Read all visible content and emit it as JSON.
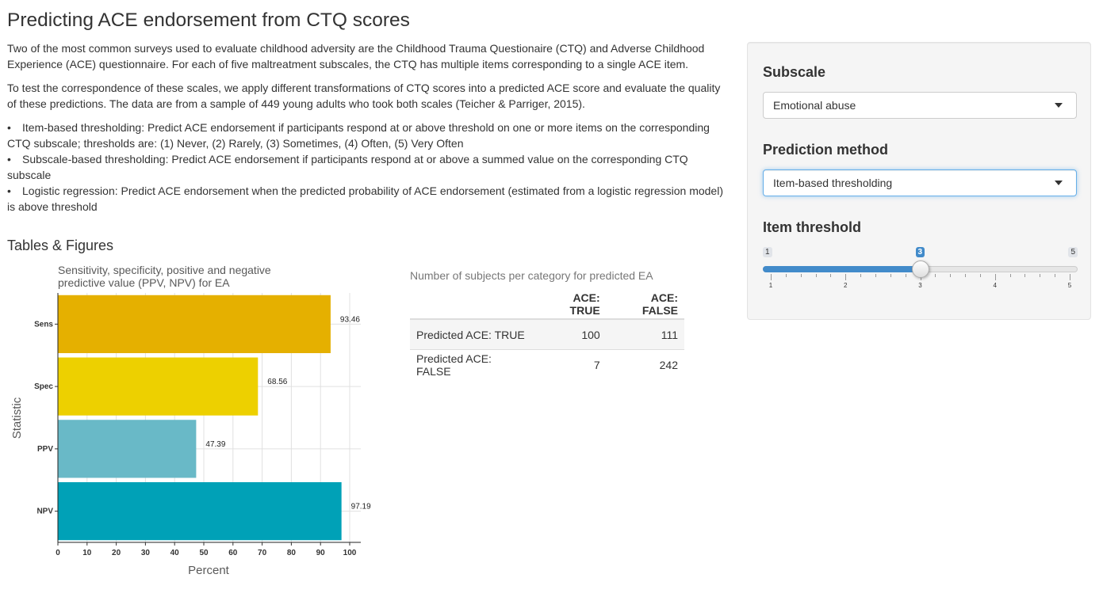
{
  "title": "Predicting ACE endorsement from CTQ scores",
  "intro": [
    "Two of the most common surveys used to evaluate childhood adversity are the Childhood Trauma Questionaire (CTQ) and Adverse Childhood Experience (ACE) questionnaire. For each of five maltreatment subscales, the CTQ has multiple items corresponding to a single ACE item.",
    "To test the correspondence of these scales, we apply different transformations of CTQ scores into a predicted ACE score and evaluate the quality of these predictions. The data are from a sample of 449 young adults who took both scales (Teicher & Parriger, 2015)."
  ],
  "methods": [
    "Item-based thresholding: Predict ACE endorsement if participants respond at or above threshold on one or more items on the corresponding CTQ subscale; thresholds are: (1) Never, (2) Rarely, (3) Sometimes, (4) Often, (5) Very Often",
    "Subscale-based thresholding: Predict ACE endorsement if participants respond at or above a summed value on the corresponding CTQ subscale",
    "Logistic regression: Predict ACE endorsement when the predicted probability of ACE endorsement (estimated from a logistic regression model) is above threshold"
  ],
  "section_heading": "Tables & Figures",
  "chart_data": {
    "type": "bar",
    "orientation": "horizontal",
    "title": "Sensitivity, specificity, positive and negative predictive value (PPV, NPV) for EA",
    "title_lines": [
      "Sensitivity, specificity, positive and negative",
      "predictive value (PPV, NPV) for EA"
    ],
    "xlabel": "Percent",
    "ylabel": "Statistic",
    "categories": [
      "Sens",
      "Spec",
      "PPV",
      "NPV"
    ],
    "values": [
      93.46,
      68.56,
      47.39,
      97.19
    ],
    "value_labels": [
      "93.46",
      "68.56",
      "47.39",
      "97.19"
    ],
    "colors": [
      "#e5b000",
      "#edd000",
      "#69b9c7",
      "#00a1b7"
    ],
    "xlim": [
      0,
      100
    ],
    "xticks": [
      0,
      10,
      20,
      30,
      40,
      50,
      60,
      70,
      80,
      90,
      100
    ],
    "grid": true
  },
  "table": {
    "caption": "Number of subjects per category for predicted EA",
    "headers": [
      "",
      "ACE: TRUE",
      "ACE: FALSE"
    ],
    "rows": [
      [
        "Predicted ACE: TRUE",
        "100",
        "111"
      ],
      [
        "Predicted ACE: FALSE",
        "7",
        "242"
      ]
    ]
  },
  "sidebar": {
    "subscale_label": "Subscale",
    "subscale_value": "Emotional abuse",
    "method_label": "Prediction method",
    "method_value": "Item-based thresholding",
    "threshold_label": "Item threshold",
    "slider": {
      "min": 1,
      "max": 5,
      "value": 3,
      "min_label": "1",
      "max_label": "5",
      "value_label": "3",
      "tick_labels": [
        "1",
        "2",
        "3",
        "4",
        "5"
      ],
      "accent": "#428bca"
    }
  }
}
